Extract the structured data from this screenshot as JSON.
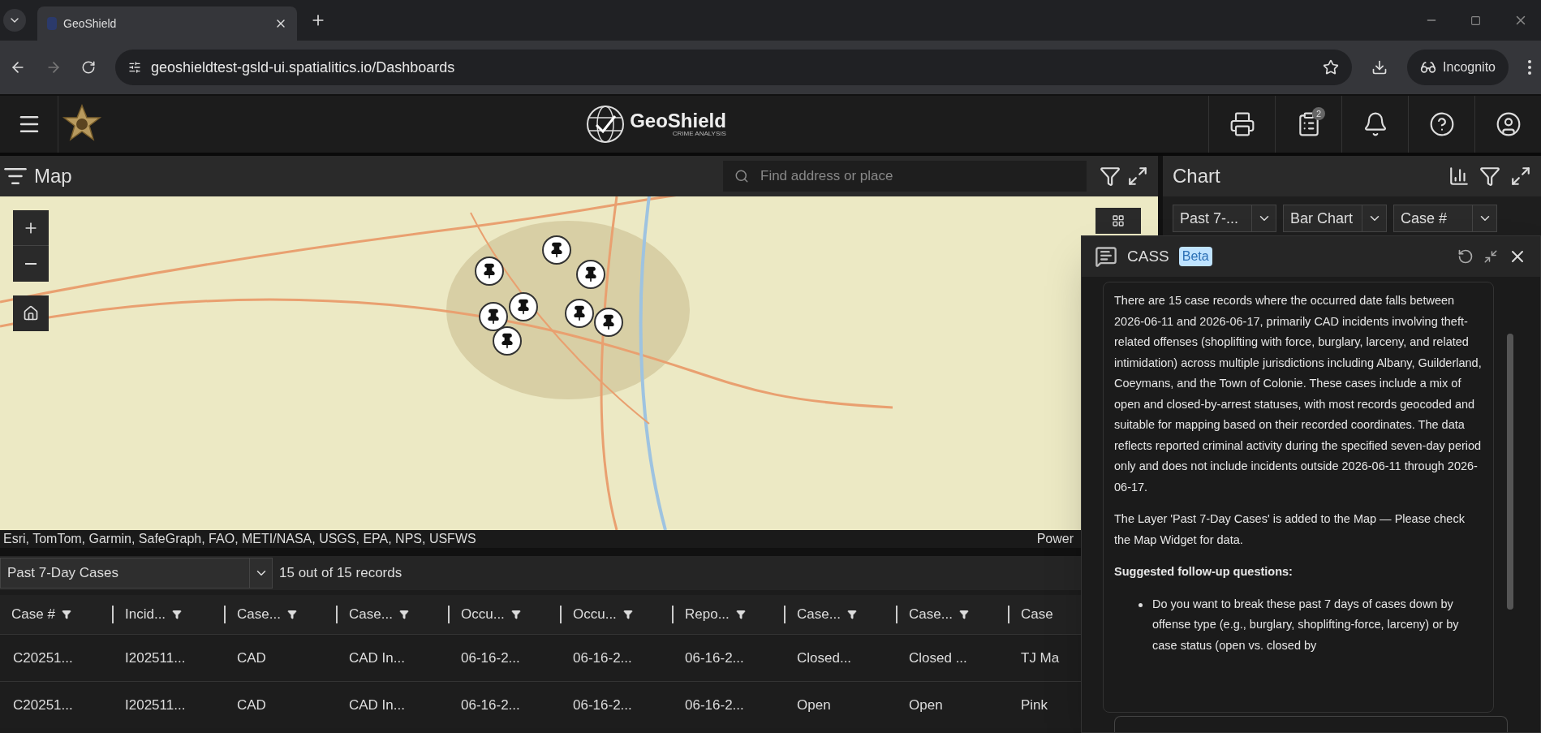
{
  "browser": {
    "tabs": [
      {
        "title": "GeoShield",
        "selected": true
      }
    ],
    "url": "geoshieldtest-gsld-ui.spatialitics.io/Dashboards",
    "profile": "Incognito"
  },
  "header": {
    "logo_title": "GeoShield",
    "logo_subtitle": "CRIME ANALYSIS",
    "notes_badge": "2"
  },
  "map": {
    "title": "Map",
    "search_placeholder": "Find address or place",
    "attribution": "Esri, TomTom, Garmin, SafeGraph, FAO, METI/NASA, USGS, EPA, NPS, USFWS",
    "powered": "Power"
  },
  "chart": {
    "title": "Chart",
    "dropdowns": [
      "Past 7-...",
      "Bar Chart",
      "Case #"
    ]
  },
  "table": {
    "layer": "Past 7-Day Cases",
    "count": "15 out of 15 records",
    "columns": [
      "Case #",
      "Incid...",
      "Case...",
      "Case...",
      "Occu...",
      "Occu...",
      "Repo...",
      "Case...",
      "Case...",
      "Case"
    ],
    "rows": [
      [
        "C20251...",
        "I202511...",
        "CAD",
        "CAD In...",
        "06-16-2...",
        "06-16-2...",
        "06-16-2...",
        "Closed...",
        "Closed ...",
        "TJ Ma"
      ],
      [
        "C20251...",
        "I202511...",
        "CAD",
        "CAD In...",
        "06-16-2...",
        "06-16-2...",
        "06-16-2...",
        "Open",
        "Open",
        "Pink"
      ]
    ]
  },
  "assistant": {
    "title": "CASS",
    "badge": "Beta",
    "paragraphs": [
      "There are 15 case records where the occurred date falls between 2026-06-11 and 2026-06-17, primarily CAD incidents involving theft-related offenses (shoplifting with force, burglary, larceny, and related intimidation) across multiple jurisdictions including Albany, Guilderland, Coeymans, and the Town of Colonie. These cases include a mix of open and closed-by-arrest statuses, with most records geocoded and suitable for mapping based on their recorded coordinates. The data reflects reported criminal activity during the specified seven-day period only and does not include incidents outside 2026-06-11 through 2026-06-17.",
      "The Layer 'Past 7-Day Cases' is added to the Map — Please check the Map Widget for data."
    ],
    "followup_heading": "Suggested follow-up questions:",
    "followups": [
      "Do you want to break these past 7 days of cases down by offense type (e.g., burglary, shoplifting-force, larceny) or by case status (open vs. closed by"
    ]
  }
}
